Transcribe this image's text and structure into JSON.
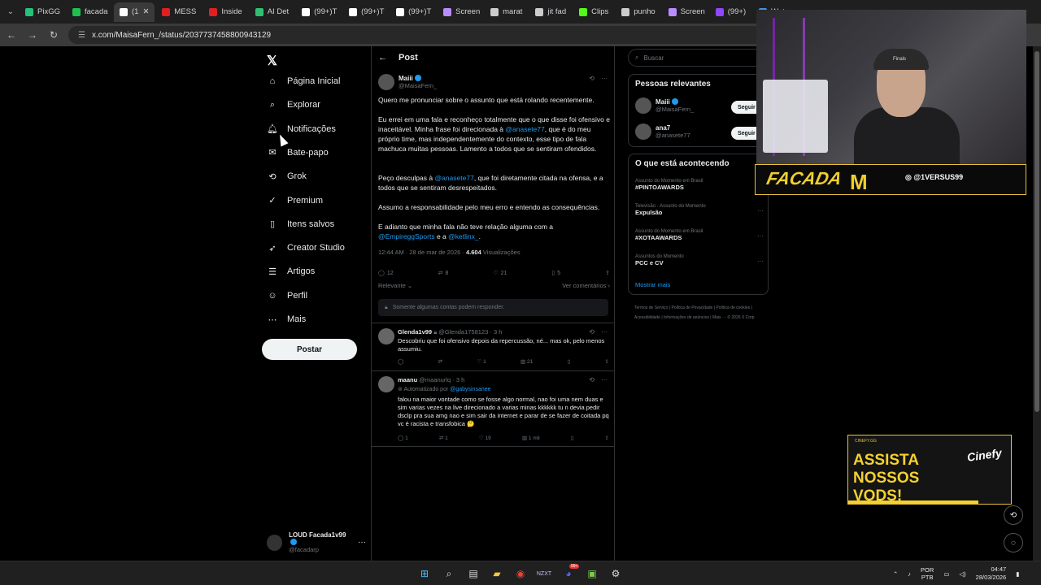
{
  "browser": {
    "tabs": [
      {
        "label": "PixGG",
        "color": "#27c27a",
        "active": false
      },
      {
        "label": "facada",
        "color": "#20c050",
        "active": false
      },
      {
        "label": "(1",
        "color": "#ffffff",
        "active": true
      },
      {
        "label": "MESS",
        "color": "#e02020",
        "active": false
      },
      {
        "label": "Inside",
        "color": "#e02020",
        "active": false
      },
      {
        "label": "AI Det",
        "color": "#2fbf71",
        "active": false
      },
      {
        "label": "(99+)T",
        "color": "#ffffff",
        "active": false
      },
      {
        "label": "(99+)T",
        "color": "#ffffff",
        "active": false
      },
      {
        "label": "(99+)T",
        "color": "#ffffff",
        "active": false
      },
      {
        "label": "Screen",
        "color": "#b98cff",
        "active": false
      },
      {
        "label": "marat",
        "color": "#cccccc",
        "active": false
      },
      {
        "label": "jit fad",
        "color": "#cccccc",
        "active": false
      },
      {
        "label": "Clips",
        "color": "#53fc18",
        "active": false
      },
      {
        "label": "punho",
        "color": "#cccccc",
        "active": false
      },
      {
        "label": "Screen",
        "color": "#b98cff",
        "active": false
      },
      {
        "label": "(99+)",
        "color": "#9146ff",
        "active": false
      },
      {
        "label": "Wat",
        "color": "#4a90e2",
        "active": false
      }
    ],
    "url": "x.com/MaisaFern_/status/2037737458800943129"
  },
  "sidebar": {
    "items": [
      {
        "label": "Página Inicial",
        "icon": "home-icon"
      },
      {
        "label": "Explorar",
        "icon": "search-icon"
      },
      {
        "label": "Notificações",
        "icon": "bell-icon"
      },
      {
        "label": "Bate-papo",
        "icon": "mail-icon"
      },
      {
        "label": "Grok",
        "icon": "grok-icon"
      },
      {
        "label": "Premium",
        "icon": "verified-icon"
      },
      {
        "label": "Itens salvos",
        "icon": "bookmark-icon"
      },
      {
        "label": "Creator Studio",
        "icon": "rocket-icon"
      },
      {
        "label": "Artigos",
        "icon": "articles-icon"
      },
      {
        "label": "Perfil",
        "icon": "profile-icon"
      },
      {
        "label": "Mais",
        "icon": "more-icon"
      }
    ],
    "post_button": "Postar",
    "account": {
      "name": "LOUD Facada1v99",
      "handle": "@facadarp"
    }
  },
  "post": {
    "header": "Post",
    "author": {
      "name": "Maiii",
      "handle": "@MaisaFern_"
    },
    "paragraphs": {
      "p1": "Quero me pronunciar sobre o assunto que está rolando recentemente.",
      "p2a": "Eu errei em uma fala e reconheço totalmente que o que disse foi ofensivo e inaceitável. Minha frase foi direcionada à ",
      "p2m": "@anasete77",
      "p2b": ", que é do meu próprio time, mas independentemente do contexto, esse tipo de fala machuca muitas pessoas. Lamento a todos que se sentiram ofendidos.",
      "p3a": "Peço desculpas à ",
      "p3m": "@anasete77",
      "p3b": ", que foi diretamente citada na ofensa, e a todos que se sentiram desrespeitados.",
      "p4": "Assumo a responsabilidade pelo meu erro e entendo as consequências.",
      "p5a": "E adianto que minha fala não teve relação alguma com a ",
      "p5m1": "@EmpireggSports",
      "p5mid": "  e a ",
      "p5m2": "@ketlinx_",
      "p5end": "."
    },
    "timestamp": "12:44 AM · 28 de mar de 2026 · ",
    "views_count": "4.604",
    "views_label": " Visualizações",
    "stats": {
      "replies": "12",
      "reposts": "8",
      "likes": "21",
      "bookmarks": "5"
    },
    "sort_label": "Relevante",
    "see_quotes": "Ver comentários",
    "restricted_notice": "Somente algumas contas podem responder."
  },
  "replies": [
    {
      "name": "Glenda1v99",
      "handle": "@Glenda1758123 · 3 h",
      "text": "Descobriu que foi ofensivo depois da repercussão, né... mas ok, pelo menos assumiu.",
      "replies": "",
      "reposts": "",
      "likes": "1",
      "views": "21"
    },
    {
      "name": "maanu",
      "handle": "@maanurlq · 3 h",
      "automated": "Automatizado por ",
      "automated_by": "@gabysinsanee",
      "text": "falou na maior vontade como se fosse algo normal, nao foi uma nem duas e sim varias vezes na live direcionado a varias minas kkkkkk tu n devia pedir dsclp pra sua amg nao e sim sair da internet e parar de se fazer de coitada pq vc é racista e transfobica 🤔",
      "replies": "1",
      "reposts": "1",
      "likes": "19",
      "views": "1 mil"
    }
  ],
  "right": {
    "search_placeholder": "Buscar",
    "people_title": "Pessoas relevantes",
    "people": [
      {
        "name": "Maiii",
        "handle": "@MaisaFern_",
        "action": "Seguir"
      },
      {
        "name": "ana7",
        "handle": "@anasete77",
        "action": "Seguir"
      }
    ],
    "trends_title": "O que está acontecendo",
    "trends": [
      {
        "context": "Assunto do Momento em Brasil",
        "title": "#PINTOAWARDS"
      },
      {
        "context": "Televisão · Assunto do Momento",
        "title": "Expulsão"
      },
      {
        "context": "Assunto do Momento em Brasil",
        "title": "#XOTAAWARDS"
      },
      {
        "context": "Assuntos do Momento",
        "title": "PCC e CV"
      }
    ],
    "show_more": "Mostrar mais",
    "footer": "Termos de Serviço  |  Política de Privacidade  |  Política de cookies  |  Acessibilidade  |  Informações de anúncios  |  Mais ···  © 2026 X Corp."
  },
  "overlay": {
    "banner_text": "FACADA",
    "banner_mark": "M",
    "banner_handle": "◎ @1VERSUS99",
    "cap_text": "Finals",
    "ad_top": "CINEFY.GG",
    "ad_text": "ASSISTA NOSSOS VODS!",
    "ad_brand": "Cinefy"
  },
  "taskbar": {
    "lang_top": "POR",
    "lang_bottom": "PTB",
    "time": "04:47",
    "date": "28/03/2026",
    "discord_badge": "99+"
  }
}
